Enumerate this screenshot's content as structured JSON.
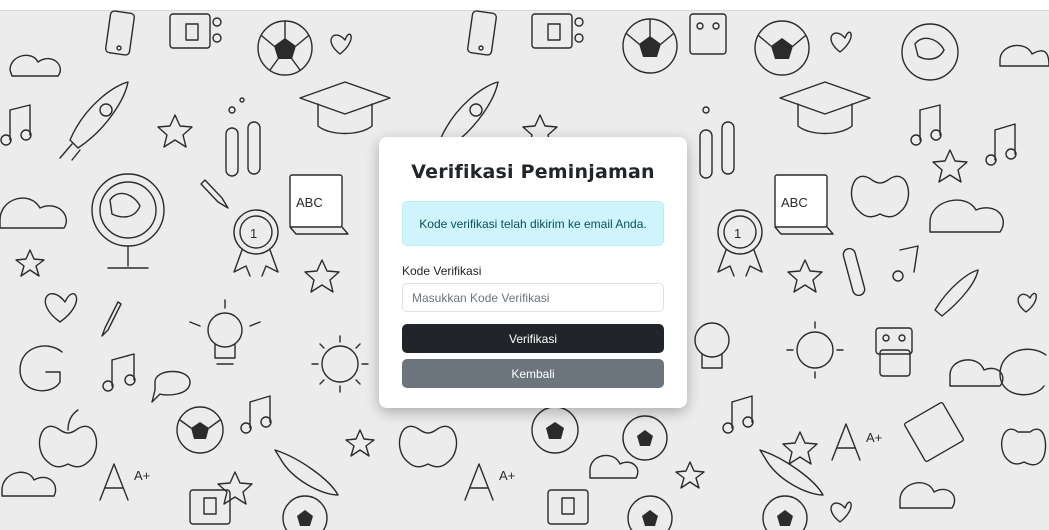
{
  "card": {
    "title": "Verifikasi Peminjaman",
    "alert_text": "Kode verifikasi telah dikirim ke email Anda.",
    "code_label": "Kode Verifikasi",
    "code_value": "",
    "code_placeholder": "Masukkan Kode Verifikasi",
    "verify_button": "Verifikasi",
    "back_button": "Kembali"
  },
  "background": {
    "book_text": "ABC",
    "medal_text": "1",
    "grade_text": "A+"
  },
  "colors": {
    "alert_bg": "#cff4fc",
    "alert_text": "#055160",
    "primary_button": "#212529",
    "secondary_button": "#6c757d",
    "background": "#ececec"
  },
  "icons": [
    "soccer-ball-icon",
    "robot-icon",
    "rocket-icon",
    "globe-icon",
    "book-icon",
    "medal-icon",
    "lightbulb-icon",
    "music-note-icon",
    "star-icon",
    "heart-icon",
    "cloud-icon",
    "sun-icon",
    "apple-icon",
    "pencil-icon",
    "test-tube-icon",
    "graduation-cap-icon",
    "phone-icon",
    "grade-icon"
  ]
}
